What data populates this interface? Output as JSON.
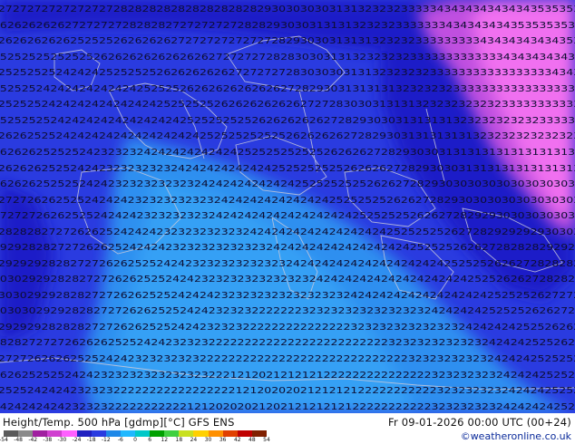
{
  "header": {
    "title_left": "Height/Temp. 500 hPa [gdmp][°C] GFS ENS",
    "title_right": "Fr 09-01-2026 00:00 UTC (00+24)",
    "credit": "©weatheronline.co.uk"
  },
  "legend": {
    "ticks": [
      "-54",
      "-48",
      "-42",
      "-38",
      "-30",
      "-24",
      "-18",
      "-12",
      "-6",
      "0",
      "6",
      "12",
      "18",
      "24",
      "30",
      "36",
      "42",
      "48",
      "54"
    ],
    "colors": [
      "#5a5a5a",
      "#8a8a8a",
      "#a020a0",
      "#d040d0",
      "#ff60ff",
      "#2020c0",
      "#2a3be0",
      "#1e88e8",
      "#20b8ff",
      "#00c8c8",
      "#00a000",
      "#40d040",
      "#c8e020",
      "#ffd000",
      "#ff9000",
      "#e04000",
      "#c00000",
      "#802000"
    ]
  },
  "colors": {
    "deep_blue": "#1e1ec8",
    "blue": "#2a3be0",
    "light_blue": "#2f8ff0",
    "pink": "#f070f0",
    "magenta_edge": "#c050e0",
    "border": "#c8c8d8"
  },
  "map": {
    "rows": [
      {
        "row": "r00",
        "text": "2727272727272727282828282828282828282930303030313132323233333434343434343435353535"
      },
      {
        "row": "r01",
        "text": "2626262626272727272828282727272727282829303031313132323233333334343434343535353535"
      },
      {
        "row": "r02",
        "text": "2626262626252525262626262727272727272728293030313131323232333333333434343434343535"
      },
      {
        "row": "r03",
        "text": "2525252525252526262626262626262727272728283030313132323232333333333333343434343434"
      },
      {
        "row": "r04",
        "text": "2525252524242425252525262626262627272727283030303131323232323333333333333333343434"
      },
      {
        "row": "r05",
        "text": "2525252424242424242425252526262626262626272829303131313132323232333333333333333333"
      },
      {
        "row": "r06",
        "text": "2525252424242424242424252525252626262626262727283030313131323232323232333333333333"
      },
      {
        "row": "r07",
        "text": "2525252524242424242424242425252525252626262626272829303031313131323232323232333333"
      },
      {
        "row": "r08",
        "text": "2626252524242424242424242424252525252525262626262728293031313131313232323232323232"
      },
      {
        "row": "r09",
        "text": "2626262525252423232324242424242424252525252525262626272829303031313131313131313131"
      },
      {
        "row": "r10",
        "text": "2626262525242423232323232424242424242425252525252626262728293030313131313131313131"
      },
      {
        "row": "r11",
        "text": "2626262525252424232323232323242424242424242525252525262627282930303030303030303030"
      },
      {
        "row": "r12",
        "text": "2727262625252424242323232323232424242424242424252525252626272829303030303030303030"
      },
      {
        "row": "r13",
        "text": "2727272626252524242423232323232424242424242424242425252525262627282929303030303030"
      },
      {
        "row": "r14",
        "text": "2828282727262625242424232323232323242424242424242424242525252526272829292929303030"
      },
      {
        "row": "r15",
        "text": "2929282827272626252424242323232323232324242424242424242424252525262627282828292929"
      },
      {
        "row": "r16",
        "text": "2929292828272726262525242423232323232323242424242424242424242425252526262728282828"
      },
      {
        "row": "r17",
        "text": "3030292928282727262625252424232323232323232324242424242424242424242525262627282828"
      },
      {
        "row": "r18",
        "text": "3030292928282727262625252424242323232323232323232424242424242424242425252526272727"
      },
      {
        "row": "r19",
        "text": "3030302929282827272626252524242323232222222323232323232323232424242425252526262727"
      },
      {
        "row": "r20",
        "text": "2929292828282727262625252424232323222222222222222323232323232323242424242525262626"
      },
      {
        "row": "r21",
        "text": "2828272727262626252524242323232222222222222222222222222323232323232324242425252626"
      },
      {
        "row": "r22",
        "text": "2727262626252524242323232323222222222222222222222222222223232323232324242425252526"
      },
      {
        "row": "r23",
        "text": "2626252525242423232323232323232221212021212121222222222222222323232323242424252525"
      },
      {
        "row": "r24",
        "text": "2525242424232323222222222222222221212020202121212122222222222323232323242424252526"
      },
      {
        "row": "r25",
        "text": "2424242424232323222222222221212020202120212121212122222222222323232323242424242525"
      }
    ]
  }
}
